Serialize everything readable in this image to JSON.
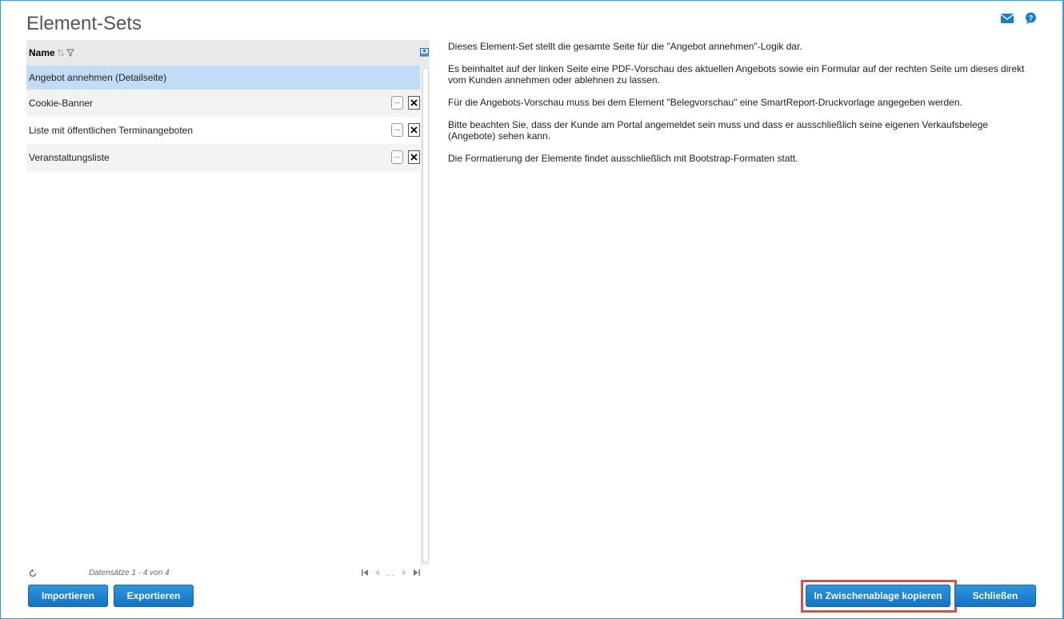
{
  "page": {
    "title": "Element-Sets"
  },
  "top_icons": [
    "mail-icon",
    "help-icon"
  ],
  "grid": {
    "column_name": "Name",
    "rows": [
      {
        "name": "Angebot annehmen (Detailseite)",
        "selected": true,
        "has_actions": false
      },
      {
        "name": "Cookie-Banner",
        "selected": false,
        "has_actions": true
      },
      {
        "name": "Liste mit öffentlichen Terminangeboten",
        "selected": false,
        "has_actions": true
      },
      {
        "name": "Veranstaltungsliste",
        "selected": false,
        "has_actions": true
      }
    ],
    "more_label": "...",
    "records_text": "Datensätze 1 - 4 von 4",
    "pager_dots": "..."
  },
  "description": {
    "paragraphs": [
      "Dieses Element-Set stellt die gesamte Seite für die \"Angebot annehmen\"-Logik dar.",
      "Es beinhaltet auf der linken Seite eine PDF-Vorschau des aktuellen Angebots sowie ein Formular auf der rechten Seite um dieses direkt vom Kunden annehmen oder ablehnen zu lassen.",
      "Für die Angebots-Vorschau muss bei dem Element \"Belegvorschau\" eine SmartReport-Druckvorlage angegeben werden.",
      "Bitte beachten Sie, dass der Kunde am Portal angemeldet sein muss und dass er ausschließlich seine eigenen Verkaufsbelege (Angebote) sehen kann.",
      "Die Formatierung der Elemente findet ausschließlich mit Bootstrap-Formaten statt."
    ]
  },
  "buttons": {
    "import": "Importieren",
    "export": "Exportieren",
    "copy": "In Zwischenablage kopieren",
    "close": "Schließen"
  },
  "colors": {
    "accent": "#1a7fd0",
    "selected_row": "#c3dcf6",
    "highlight": "#e04b4b"
  }
}
